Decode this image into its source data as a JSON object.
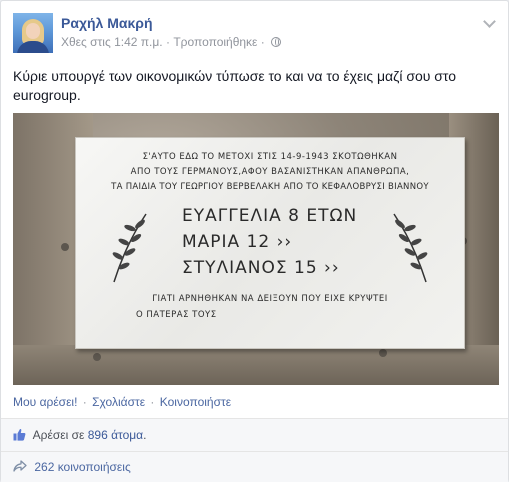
{
  "post": {
    "author_name": "Ραχήλ Μακρή",
    "timestamp": "Χθες στις 1:42 π.μ.",
    "edited_label": "Τροποποιήθηκε",
    "text": "Κύριε υπουργέ των οικονομικών τύπωσε το και να το έχεις μαζί σου στο eurogroup."
  },
  "photo": {
    "plaque_line1": "Σ'ΑΥΤΟ ΕΔΩ ΤΟ ΜΕΤΟΧΙ ΣΤΙΣ 14-9-1943 ΣΚΟΤΩΘΗΚΑΝ",
    "plaque_line2": "ΑΠΟ ΤΟΥΣ ΓΕΡΜΑΝΟΥΣ,ΑΦΟΥ ΒΑΣΑΝΙΣΤΗΚΑΝ ΑΠΑΝΘΡΩΠΑ,",
    "plaque_line3": "ΤΑ ΠΑΙΔΙΑ ΤΟΥ ΓΕΩΡΓΙΟΥ ΒΕΡΒΕΛΑΚΗ ΑΠΟ ΤΟ ΚΕΦΑΛΟΒΡΥΣΙ ΒΙΑΝΝΟΥ",
    "name1": "ΕΥΑΓΓΕΛΙΑ 8 ΕΤΩΝ",
    "name2": "ΜΑΡΙΑ 12 ››",
    "name3": "ΣΤΥΛΙΑΝΟΣ 15 ››",
    "plaque_line4": "ΓΙΑΤΙ ΑΡΝΗΘΗΚΑΝ ΝΑ ΔΕΙΞΟΥΝ ΠΟΥ ΕΙΧΕ ΚΡΥΨΤΕΙ",
    "plaque_line5": "Ο ΠΑΤΕΡΑΣ ΤΟΥΣ"
  },
  "actions": {
    "like": "Μου αρέσει!",
    "comment": "Σχολιάστε",
    "share": "Κοινοποιήστε",
    "separator": "·"
  },
  "likes": {
    "prefix": "Αρέσει σε",
    "count_link": "896 άτομα",
    "suffix": "."
  },
  "shares": {
    "label": "262 κοινοποιήσεις"
  },
  "icons": {
    "globe": "globe-icon",
    "chevron": "chevron-down-icon",
    "thumbs_up": "thumbs-up-icon",
    "share": "share-arrow-icon"
  },
  "colors": {
    "link": "#3b5998",
    "meta": "#90949c",
    "background": "#ffffff"
  }
}
